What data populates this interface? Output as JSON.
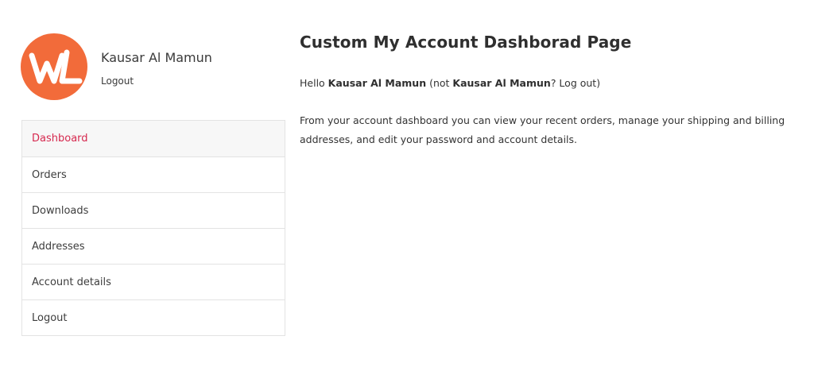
{
  "profile": {
    "name": "Kausar Al Mamun",
    "logout_label": "Logout",
    "avatar_color": "#f26b3a",
    "avatar_initials": "WL"
  },
  "nav": {
    "items": [
      {
        "label": "Dashboard",
        "active": true
      },
      {
        "label": "Orders",
        "active": false
      },
      {
        "label": "Downloads",
        "active": false
      },
      {
        "label": "Addresses",
        "active": false
      },
      {
        "label": "Account details",
        "active": false
      },
      {
        "label": "Logout",
        "active": false
      }
    ],
    "active_color": "#d6294f"
  },
  "main": {
    "title": "Custom My Account Dashborad Page",
    "hello_prefix": "Hello ",
    "hello_name": "Kausar Al Mamun",
    "hello_mid": " (not ",
    "hello_name2": "Kausar Al Mamun",
    "hello_suffix": "? Log out)",
    "description": "From your account dashboard you can view your recent orders, manage your shipping and billing addresses, and edit your password and account details."
  }
}
